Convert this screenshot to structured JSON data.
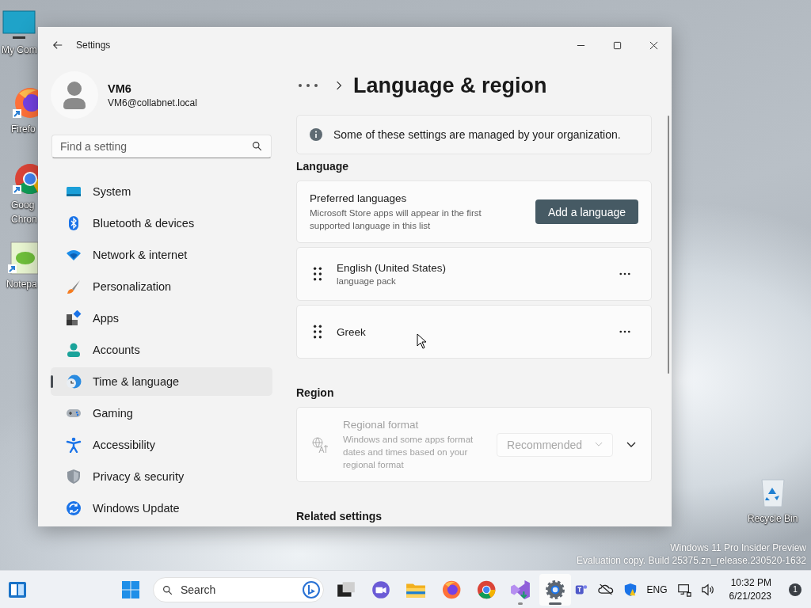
{
  "desktop_icons": [
    {
      "kind": "computer",
      "label_lines": [
        "My Com"
      ]
    },
    {
      "kind": "firefox",
      "label_lines": [
        "Firefo"
      ]
    },
    {
      "kind": "chrome",
      "label_lines": [
        "Goog",
        "Chron"
      ]
    },
    {
      "kind": "notepad",
      "label_lines": [
        "Notepa"
      ]
    },
    {
      "kind": "recycle",
      "label_lines": [
        "Recycle Bin"
      ]
    }
  ],
  "window": {
    "title": "Settings"
  },
  "account": {
    "name": "VM6",
    "email": "VM6@collabnet.local"
  },
  "search": {
    "placeholder": "Find a setting"
  },
  "sidebar": {
    "items": [
      {
        "kind": "system",
        "label": "System",
        "selected": false
      },
      {
        "kind": "bluetooth",
        "label": "Bluetooth & devices",
        "selected": false
      },
      {
        "kind": "network",
        "label": "Network & internet",
        "selected": false
      },
      {
        "kind": "personalization",
        "label": "Personalization",
        "selected": false
      },
      {
        "kind": "apps",
        "label": "Apps",
        "selected": false
      },
      {
        "kind": "accounts",
        "label": "Accounts",
        "selected": false
      },
      {
        "kind": "time",
        "label": "Time & language",
        "selected": true
      },
      {
        "kind": "gaming",
        "label": "Gaming",
        "selected": false
      },
      {
        "kind": "accessibility",
        "label": "Accessibility",
        "selected": false
      },
      {
        "kind": "privacy",
        "label": "Privacy & security",
        "selected": false
      },
      {
        "kind": "update",
        "label": "Windows Update",
        "selected": false
      }
    ]
  },
  "page_title": "Language & region",
  "notice": "Some of these settings are managed by your organization.",
  "language": {
    "heading": "Language",
    "preferred": {
      "title": "Preferred languages",
      "description": "Microsoft Store apps will appear in the first supported language in this list",
      "button": "Add a language"
    },
    "languages": [
      {
        "name": "English (United States)",
        "detail": "language pack"
      },
      {
        "name": "Greek"
      }
    ]
  },
  "region": {
    "heading": "Region",
    "regional_format": {
      "title": "Regional format",
      "description": "Windows and some apps format dates and times based on your regional format",
      "value": "Recommended",
      "disabled": true
    }
  },
  "related_heading": "Related settings",
  "desktop_notice": [
    "Windows 11 Pro Insider Preview",
    "Evaluation copy. Build 25375.zn_release.230520-1632"
  ],
  "taskbar": {
    "search_placeholder": "Search",
    "apps": [
      {
        "kind": "taskview",
        "running": false,
        "selected": false
      },
      {
        "kind": "chat",
        "running": false,
        "selected": false
      },
      {
        "kind": "explorer",
        "running": false,
        "selected": false
      },
      {
        "kind": "firefox",
        "running": false,
        "selected": false
      },
      {
        "kind": "chrome",
        "running": false,
        "selected": false
      },
      {
        "kind": "studio",
        "running": true,
        "selected": false
      },
      {
        "kind": "settings",
        "running": true,
        "selected": true
      }
    ],
    "tray": {
      "language": "ENG",
      "time": "10:32 PM",
      "date": "6/21/2023",
      "notifications": "1"
    }
  }
}
